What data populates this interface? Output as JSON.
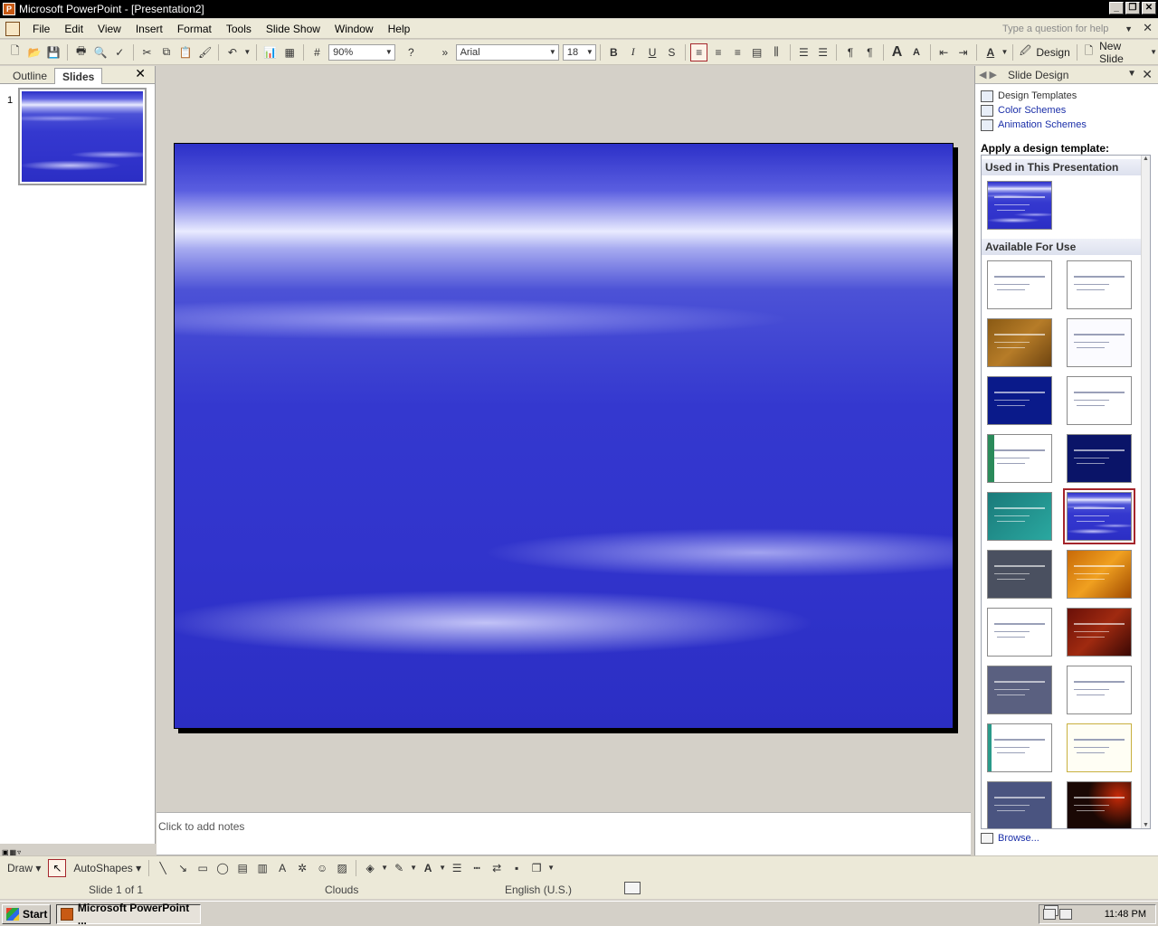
{
  "window": {
    "title": "Microsoft PowerPoint - [Presentation2]"
  },
  "menu": {
    "items": [
      {
        "label": "File"
      },
      {
        "label": "Edit"
      },
      {
        "label": "View"
      },
      {
        "label": "Insert"
      },
      {
        "label": "Format"
      },
      {
        "label": "Tools"
      },
      {
        "label": "Slide Show"
      },
      {
        "label": "Window"
      },
      {
        "label": "Help"
      }
    ],
    "help_placeholder": "Type a question for help"
  },
  "toolbar": {
    "zoom": "90%",
    "font": "Arial",
    "font_size": "18",
    "design_label": "Design",
    "new_slide_label": "New Slide"
  },
  "left_pane": {
    "tabs": [
      {
        "label": "Outline"
      },
      {
        "label": "Slides"
      }
    ],
    "slide_number": "1"
  },
  "notes": {
    "placeholder": "Click to add notes"
  },
  "task_pane": {
    "title": "Slide Design",
    "links": [
      {
        "label": "Design Templates"
      },
      {
        "label": "Color Schemes"
      },
      {
        "label": "Animation Schemes"
      }
    ],
    "apply_heading": "Apply a design template:",
    "used_heading": "Used in This Presentation",
    "available_heading": "Available For Use",
    "browse_label": "Browse..."
  },
  "drawing_toolbar": {
    "draw_label": "Draw",
    "autoshapes_label": "AutoShapes"
  },
  "status": {
    "slide": "Slide 1 of 1",
    "design": "Clouds",
    "language": "English (U.S.)"
  },
  "taskbar": {
    "start_label": "Start",
    "app_label": "Microsoft PowerPoint ...",
    "clock": "11:48 PM"
  },
  "colors": {
    "slide_blue": "#3438cf",
    "selection": "#a5262c",
    "link": "#1a2ea8"
  }
}
